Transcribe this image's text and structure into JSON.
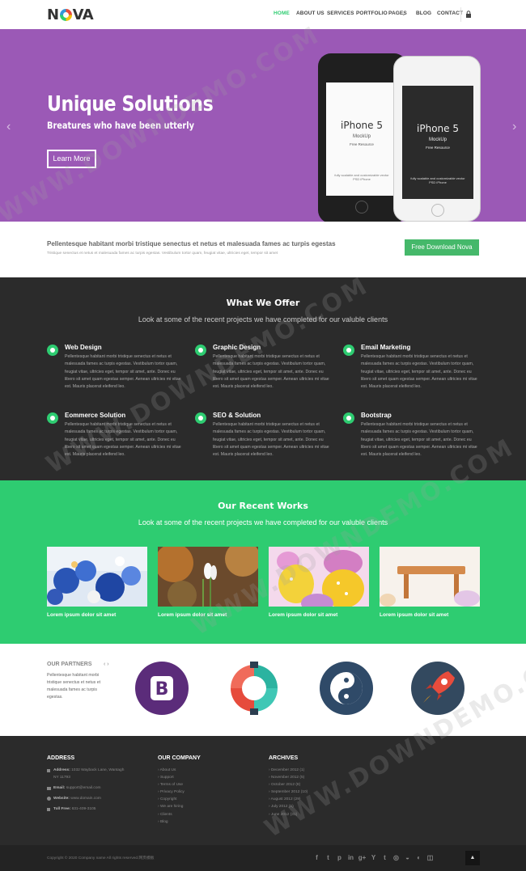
{
  "header": {
    "logo": "NOVA",
    "nav": [
      "HOME",
      "ABOUT US",
      "SERVICES",
      "PORTFOLIO",
      "PAGES",
      "BLOG",
      "CONTACT"
    ],
    "pages_chevron": "⌄"
  },
  "hero": {
    "title": "Unique Solutions",
    "subtitle": "Breatures who have been utterly",
    "button": "Learn More",
    "prev_arrow": "‹",
    "next_arrow": "›",
    "phone_black": {
      "model": "iPhone 5",
      "mock": "MockUp",
      "free": "Free Resource",
      "note": "fully scalable and customizable vector PSD iPhone"
    },
    "phone_white": {
      "model": "iPhone 5",
      "mock": "MockUp",
      "free": "Free Resource",
      "note": "fully scalable and customizable vector PSD iPhone"
    }
  },
  "callout": {
    "title": "Pellentesque habitant morbi tristique senectus et netus et malesuada fames ac turpis egestas",
    "text": "Tristique senectus et netus et malesuada fames ac turpis egestas. Vestibulum tortor quam, feugiat vitae, ultricies eget, tempor sit amet",
    "button": "Free Download Nova"
  },
  "offer": {
    "title": "What We Offer",
    "subtitle": "Look at some of the recent projects we have completed for our valuble clients",
    "features": [
      {
        "title": "Web Design",
        "text": "Pellentesque habitant morbi tristique senectus et netus et malesuada fames ac turpis egestas. Vestibulum tortor quam, feugiat vitae, ultricies eget, tempor sit amet, ante. Donec eu libero sit amet quam egestas semper. Aenean ultricies mi vitae est. Mauris placerat eleifend leo."
      },
      {
        "title": "Graphic Design",
        "text": "Pellentesque habitant morbi tristique senectus et netus et malesuada fames ac turpis egestas. Vestibulum tortor quam, feugiat vitae, ultricies eget, tempor sit amet, ante. Donec eu libero sit amet quam egestas semper. Aenean ultricies mi vitae est. Mauris placerat eleifend leo."
      },
      {
        "title": "Email Marketing",
        "text": "Pellentesque habitant morbi tristique senectus et netus et malesuada fames ac turpis egestas. Vestibulum tortor quam, feugiat vitae, ultricies eget, tempor sit amet, ante. Donec eu libero sit amet quam egestas semper. Aenean ultricies mi vitae est. Mauris placerat eleifend leo."
      },
      {
        "title": "Eommerce Solution",
        "text": "Pellentesque habitant morbi tristique senectus et netus et malesuada fames ac turpis egestas. Vestibulum tortor quam, feugiat vitae, ultricies eget, tempor sit amet, ante. Donec eu libero sit amet quam egestas semper. Aenean ultricies mi vitae est. Mauris placerat eleifend leo."
      },
      {
        "title": "SEO & Solution",
        "text": "Pellentesque habitant morbi tristique senectus et netus et malesuada fames ac turpis egestas. Vestibulum tortor quam, feugiat vitae, ultricies eget, tempor sit amet, ante. Donec eu libero sit amet quam egestas semper. Aenean ultricies mi vitae est. Mauris placerat eleifend leo."
      },
      {
        "title": "Bootstrap",
        "text": "Pellentesque habitant morbi tristique senectus et netus et malesuada fames ac turpis egestas. Vestibulum tortor quam, feugiat vitae, ultricies eget, tempor sit amet, ante. Donec eu libero sit amet quam egestas semper. Aenean ultricies mi vitae est. Mauris placerat eleifend leo."
      }
    ]
  },
  "works": {
    "title": "Our Recent Works",
    "subtitle": "Look at some of the recent projects we have completed for our valuble clients",
    "items": [
      {
        "caption": "Lorem ipsum dolor sit amet"
      },
      {
        "caption": "Lorem ipsum dolor sit amet"
      },
      {
        "caption": "Lorem ipsum dolor sit amet"
      },
      {
        "caption": "Lorem ipsum dolor sit amet"
      }
    ]
  },
  "partners": {
    "title": "OUR PARTNERS",
    "nav": "‹ ›",
    "text": "Pellentesque habitant morbi tristique senectus et netus et malesuada fames ac turpis egestas.",
    "bootstrap_letter": "B"
  },
  "footer": {
    "address": {
      "title": "ADDRESS",
      "lines": [
        {
          "label": "Address:",
          "value": "1032 Wayback Lane, Wantagh"
        },
        {
          "label": "",
          "value": "NY 11793"
        },
        {
          "label": "Email:",
          "value": "support@email.com"
        },
        {
          "label": "Website:",
          "value": "www.domain.com"
        },
        {
          "label": "Toll Free:",
          "value": "631-409-3105"
        }
      ]
    },
    "company": {
      "title": "OUR COMPANY",
      "links": [
        "About Us",
        "Support",
        "Terms of Use",
        "Privacy Policy",
        "Copyright",
        "We are hiring",
        "Clients",
        "Blog"
      ]
    },
    "archives": {
      "title": "ARCHIVES",
      "links": [
        "December 2012 (1)",
        "November 2012 (5)",
        "October 2012 (8)",
        "September 2012 (10)",
        "August 2012 (29)",
        "July 2012 (1)",
        "June 2012 (31)"
      ]
    },
    "copyright": "Copyright © 2020 Company name All rights reserved.网页模板",
    "social": [
      "f",
      "t",
      "p",
      "in",
      "g+",
      "Y",
      "t",
      "◎",
      "◒",
      "◐",
      "◫"
    ],
    "to_top": "▲"
  },
  "watermark": [
    "WWW.DOWNDEMO.COM",
    "WWW.DOWNDEMO.COM",
    "WWW.DOWNDEMO.COM",
    "WWW.DOWNDEMO.COM"
  ]
}
